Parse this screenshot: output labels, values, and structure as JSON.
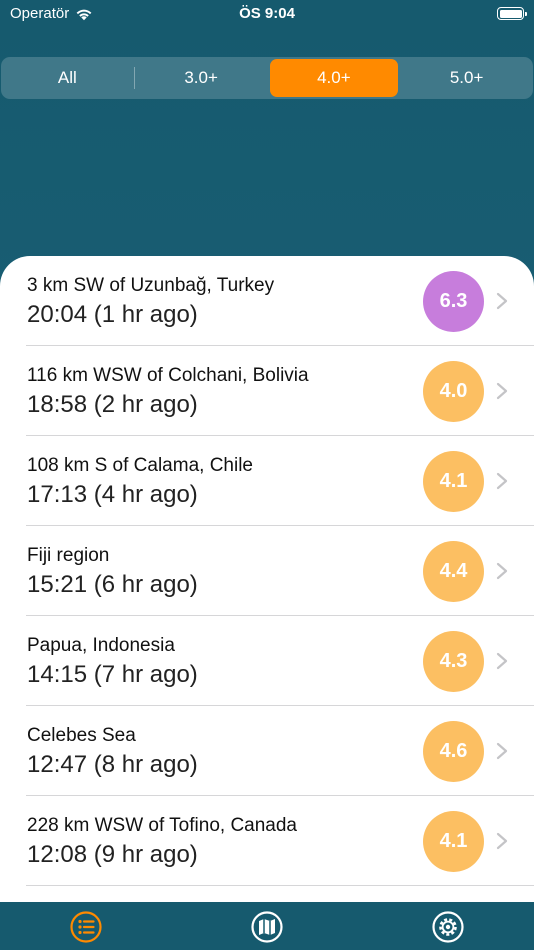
{
  "status_bar": {
    "carrier": "Operatör",
    "time": "ÖS 9:04",
    "wifi_icon": "wifi-icon",
    "battery_icon": "battery-icon"
  },
  "filter": {
    "options": [
      "All",
      "3.0+",
      "4.0+",
      "5.0+"
    ],
    "selected": "4.0+",
    "active_color": "#ff8a00"
  },
  "earthquakes": [
    {
      "place": "3 km SW of Uzunbağ, Turkey",
      "time": "20:04 (1 hr ago)",
      "magnitude": "6.3",
      "color": "#c77ddc"
    },
    {
      "place": "116 km WSW of Colchani, Bolivia",
      "time": "18:58 (2 hr ago)",
      "magnitude": "4.0",
      "color": "#fcbf62"
    },
    {
      "place": "108 km S of Calama, Chile",
      "time": "17:13 (4 hr ago)",
      "magnitude": "4.1",
      "color": "#fcbf62"
    },
    {
      "place": "Fiji region",
      "time": "15:21 (6 hr ago)",
      "magnitude": "4.4",
      "color": "#fcbf62"
    },
    {
      "place": "Papua, Indonesia",
      "time": "14:15 (7 hr ago)",
      "magnitude": "4.3",
      "color": "#fcbf62"
    },
    {
      "place": "Celebes Sea",
      "time": "12:47 (8 hr ago)",
      "magnitude": "4.6",
      "color": "#fcbf62"
    },
    {
      "place": "228 km WSW of Tofino, Canada",
      "time": "12:08 (9 hr ago)",
      "magnitude": "4.1",
      "color": "#fcbf62"
    }
  ],
  "tabs": [
    {
      "icon": "list-icon",
      "active": true
    },
    {
      "icon": "map-icon",
      "active": false
    },
    {
      "icon": "settings-icon",
      "active": false
    }
  ],
  "colors": {
    "header_bg": "#165a6e",
    "accent": "#ff8a00",
    "major_magnitude": "#c77ddc",
    "moderate_magnitude": "#fcbf62"
  }
}
